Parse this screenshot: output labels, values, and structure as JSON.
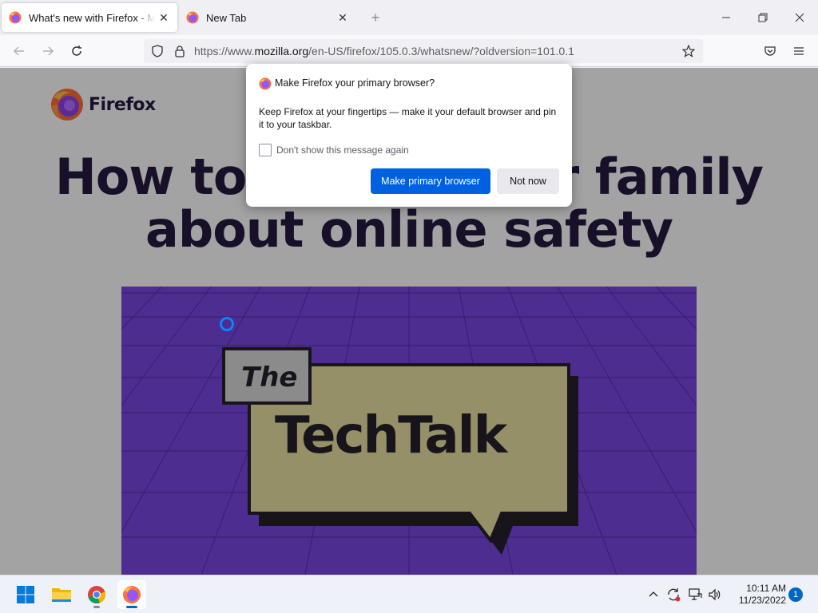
{
  "tabs": [
    {
      "title": "What's new with Firefox - More",
      "active": true
    },
    {
      "title": "New Tab",
      "active": false
    }
  ],
  "icons": {
    "new_tab": "plus-icon",
    "minimize": "minimize-icon",
    "restore": "restore-icon",
    "close": "close-icon",
    "back": "back-arrow-icon",
    "forward": "forward-arrow-icon",
    "reload": "reload-icon",
    "tracking": "shield-icon",
    "lock": "lock-icon",
    "bookmark": "star-icon",
    "pocket": "pocket-icon",
    "menu": "hamburger-menu-icon"
  },
  "urlbar": {
    "prefix": "https://www.",
    "domain": "mozilla.org",
    "path": "/en-US/firefox/105.0.3/whatsnew/?oldversion=101.0.1"
  },
  "page": {
    "brand": "Firefox",
    "headline_line1": "How to talk to your family",
    "headline_line2": "about online safety",
    "hero": {
      "label_the": "The",
      "label_title": "TechTalk"
    }
  },
  "dialog": {
    "title": "Make Firefox your primary browser?",
    "body": "Keep Firefox at your fingertips — make it your default browser and pin it to your taskbar.",
    "checkbox_label": "Don't show this message again",
    "checkbox_checked": false,
    "primary_button": "Make primary browser",
    "secondary_button": "Not now"
  },
  "taskbar": {
    "apps": [
      "windows-start",
      "file-explorer",
      "chrome",
      "firefox"
    ],
    "clock_time": "10:11 AM",
    "clock_date": "11/23/2022",
    "notification_count": "1"
  },
  "colors": {
    "accent": "#0061e0",
    "hero_bg": "#7642e2",
    "bubble": "#e9e0a0",
    "headline": "#20123a"
  }
}
